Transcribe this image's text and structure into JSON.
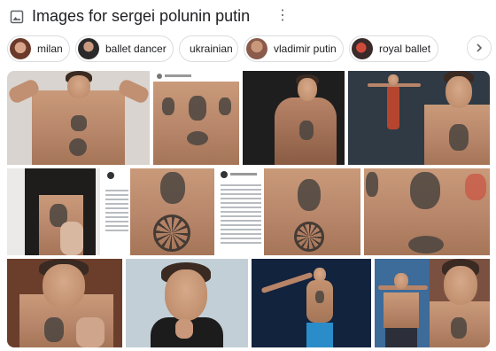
{
  "header": {
    "title": "Images for sergei polunin putin",
    "more_icon": "more-vert-icon",
    "image_icon": "image-search-icon"
  },
  "chips": [
    {
      "label": "milan",
      "has_thumb": true
    },
    {
      "label": "ballet dancer",
      "has_thumb": true
    },
    {
      "label": "ukrainian",
      "has_thumb": false
    },
    {
      "label": "vladimir putin",
      "has_thumb": true
    },
    {
      "label": "royal ballet",
      "has_thumb": true
    }
  ],
  "next_icon": "chevron-right-icon",
  "results": [
    {
      "description": "shirtless dancer flexing with tattoos"
    },
    {
      "description": "instagram post chest tattoos"
    },
    {
      "description": "dancer dark background"
    },
    {
      "description": "dancer leaping and portrait"
    },
    {
      "description": "instagram post dancer portrait"
    },
    {
      "description": "close-up chest tattoo with sun symbol"
    },
    {
      "description": "instagram screenshot text"
    },
    {
      "description": "chest tattoos close-up"
    },
    {
      "description": "chest tattoos close-up second"
    },
    {
      "description": "dancer chest tattoo portrait"
    },
    {
      "description": "dancer smiling portrait"
    },
    {
      "description": "dancer on stage blue background"
    },
    {
      "description": "dancer performing and portrait"
    }
  ],
  "colors": {
    "title": "#202124",
    "chip_border": "#dadce0",
    "icon": "#5f6368"
  }
}
